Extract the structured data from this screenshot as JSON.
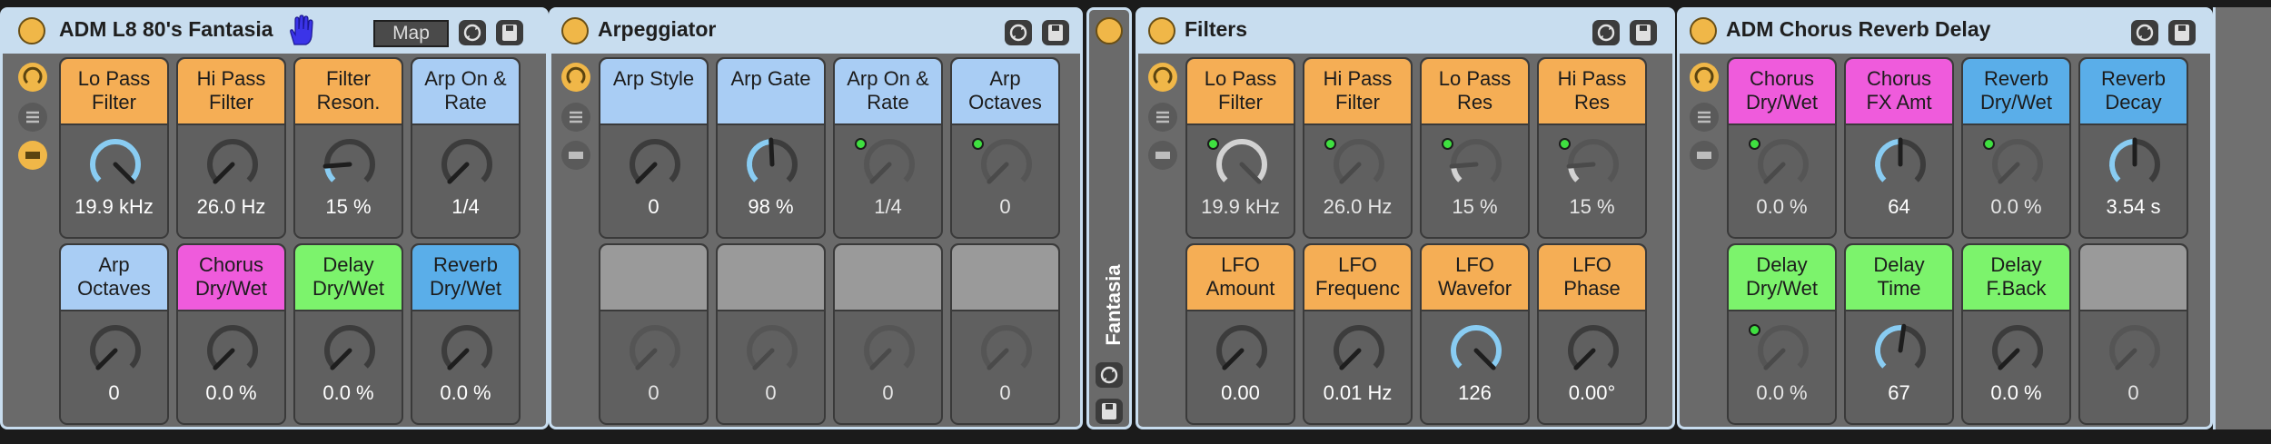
{
  "colors": {
    "orange": "#f5ae55",
    "light_blue": "#a9cdf4",
    "pink": "#ef5bdc",
    "green": "#7cf36c",
    "blue": "#5aaee9",
    "gray": "#9a9a9a",
    "header": "#c8ddef",
    "knob_active": "#89ccf2",
    "indicator": "#3fe040"
  },
  "racks": [
    {
      "title": "ADM L8 80's Fantasia",
      "map_label": "Map",
      "macros": [
        {
          "label": "Lo Pass\nFilter",
          "value": "19.9 kHz",
          "color": "orange",
          "level": 1.0,
          "active": true,
          "mapped": false
        },
        {
          "label": "Hi Pass\nFilter",
          "value": "26.0 Hz",
          "color": "orange",
          "level": 0.0,
          "active": false,
          "mapped": false
        },
        {
          "label": "Filter\nReson.",
          "value": "15 %",
          "color": "orange",
          "level": 0.15,
          "active": true,
          "mapped": false
        },
        {
          "label": "Arp On &\nRate",
          "value": "1/4",
          "color": "light_blue",
          "level": 0.0,
          "active": false,
          "mapped": false
        },
        {
          "label": "Arp\nOctaves",
          "value": "0",
          "color": "light_blue",
          "level": 0.0,
          "active": false,
          "mapped": false
        },
        {
          "label": "Chorus\nDry/Wet",
          "value": "0.0 %",
          "color": "pink",
          "level": 0.0,
          "active": false,
          "mapped": false
        },
        {
          "label": "Delay\nDry/Wet",
          "value": "0.0 %",
          "color": "green",
          "level": 0.0,
          "active": false,
          "mapped": false
        },
        {
          "label": "Reverb\nDry/Wet",
          "value": "0.0 %",
          "color": "blue",
          "level": 0.0,
          "active": false,
          "mapped": false
        }
      ]
    },
    {
      "title": "Arpeggiator",
      "macros": [
        {
          "label": "Arp Style",
          "value": "0",
          "color": "light_blue",
          "level": 0.0,
          "active": false,
          "mapped": false
        },
        {
          "label": "Arp Gate",
          "value": "98 %",
          "color": "light_blue",
          "level": 0.49,
          "active": true,
          "mapped": false
        },
        {
          "label": "Arp On &\nRate",
          "value": "1/4",
          "color": "light_blue",
          "level": 0.0,
          "active": false,
          "mapped": true,
          "dim": true
        },
        {
          "label": "Arp\nOctaves",
          "value": "0",
          "color": "light_blue",
          "level": 0.0,
          "active": false,
          "mapped": true,
          "dim": true
        },
        {
          "label": "",
          "value": "0",
          "color": "gray",
          "level": 0.0,
          "active": false,
          "mapped": false,
          "dim": true
        },
        {
          "label": "",
          "value": "0",
          "color": "gray",
          "level": 0.0,
          "active": false,
          "mapped": false,
          "dim": true
        },
        {
          "label": "",
          "value": "0",
          "color": "gray",
          "level": 0.0,
          "active": false,
          "mapped": false,
          "dim": true
        },
        {
          "label": "",
          "value": "0",
          "color": "gray",
          "level": 0.0,
          "active": false,
          "mapped": false,
          "dim": true
        }
      ]
    },
    {
      "title": "Filters",
      "macros": [
        {
          "label": "Lo Pass\nFilter",
          "value": "19.9 kHz",
          "color": "orange",
          "level": 1.0,
          "active": false,
          "mapped": true,
          "dim": true,
          "white_arc": true
        },
        {
          "label": "Hi Pass\nFilter",
          "value": "26.0 Hz",
          "color": "orange",
          "level": 0.0,
          "active": false,
          "mapped": true,
          "dim": true
        },
        {
          "label": "Lo Pass\nRes",
          "value": "15 %",
          "color": "orange",
          "level": 0.15,
          "active": false,
          "mapped": true,
          "dim": true,
          "white_arc": true
        },
        {
          "label": "Hi Pass\nRes",
          "value": "15 %",
          "color": "orange",
          "level": 0.15,
          "active": false,
          "mapped": true,
          "dim": true,
          "white_arc": true
        },
        {
          "label": "LFO\nAmount",
          "value": "0.00",
          "color": "orange",
          "level": 0.0,
          "active": false,
          "mapped": false
        },
        {
          "label": "LFO\nFrequenc",
          "value": "0.01 Hz",
          "color": "orange",
          "level": 0.0,
          "active": false,
          "mapped": false
        },
        {
          "label": "LFO\nWavefor",
          "value": "126",
          "color": "orange",
          "level": 1.0,
          "active": true,
          "mapped": false
        },
        {
          "label": "LFO\nPhase",
          "value": "0.00°",
          "color": "orange",
          "level": 0.0,
          "active": false,
          "mapped": false
        }
      ]
    },
    {
      "title": "ADM Chorus Reverb Delay",
      "macros": [
        {
          "label": "Chorus\nDry/Wet",
          "value": "0.0 %",
          "color": "pink",
          "level": 0.0,
          "active": false,
          "mapped": true,
          "dim": true
        },
        {
          "label": "Chorus\nFX Amt",
          "value": "64",
          "color": "pink",
          "level": 0.5,
          "active": true,
          "mapped": false
        },
        {
          "label": "Reverb\nDry/Wet",
          "value": "0.0 %",
          "color": "blue",
          "level": 0.0,
          "active": false,
          "mapped": true,
          "dim": true
        },
        {
          "label": "Reverb\nDecay",
          "value": "3.54 s",
          "color": "blue",
          "level": 0.5,
          "active": true,
          "mapped": false
        },
        {
          "label": "Delay\nDry/Wet",
          "value": "0.0 %",
          "color": "green",
          "level": 0.0,
          "active": false,
          "mapped": true,
          "dim": true
        },
        {
          "label": "Delay\nTime",
          "value": "67",
          "color": "green",
          "level": 0.53,
          "active": true,
          "mapped": false
        },
        {
          "label": "Delay\nF.Back",
          "value": "0.0 %",
          "color": "green",
          "level": 0.0,
          "active": false,
          "mapped": false
        },
        {
          "label": "",
          "value": "0",
          "color": "gray",
          "level": 0.0,
          "active": false,
          "mapped": false,
          "dim": true
        }
      ]
    }
  ],
  "strip_label": "Fantasia"
}
